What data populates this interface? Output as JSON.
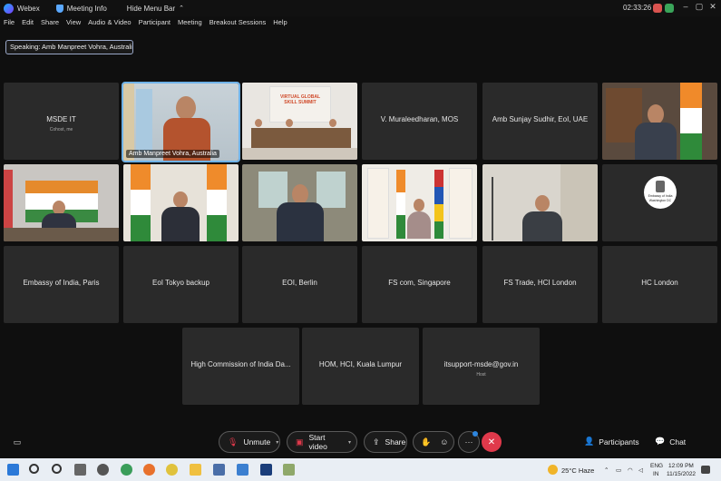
{
  "titlebar": {
    "app_name": "Webex",
    "meeting_info": "Meeting Info",
    "hide_menu": "Hide Menu Bar",
    "clock": "02:33:26"
  },
  "menu": [
    "File",
    "Edit",
    "Share",
    "View",
    "Audio & Video",
    "Participant",
    "Meeting",
    "Breakout Sessions",
    "Help"
  ],
  "speaking": "Speaking: Amb Manpreet Vohra, Australia",
  "tiles": {
    "msde": {
      "name": "MSDE IT",
      "sub": "Cohost, me"
    },
    "vohra": {
      "name": "Amb Manpreet Vohra, Australia"
    },
    "muraleedharan": {
      "name": "V. Muraleedharan, MOS"
    },
    "sudhir": {
      "name": "Amb Sunjay Sudhir, EoI, UAE"
    },
    "paris": {
      "name": "Embassy of India, Paris"
    },
    "tokyo": {
      "name": "EoI Tokyo backup"
    },
    "berlin": {
      "name": "EOI, Berlin"
    },
    "singapore": {
      "name": "FS com, Singapore"
    },
    "fs_london": {
      "name": "FS Trade, HCI London"
    },
    "hc_london": {
      "name": "HC London"
    },
    "hci_da": {
      "name": "High Commission of India Da..."
    },
    "kl": {
      "name": "HOM, HCI, Kuala Lumpur"
    },
    "itsupport": {
      "name": "itsupport-msde@gov.in",
      "sub": "Host"
    }
  },
  "banner_text": {
    "line1": "VIRTUAL GLOBAL",
    "line2": "SKILL SUMMIT"
  },
  "embassy_logo": {
    "line1": "Embassy of India",
    "line2": "Washington DC"
  },
  "controls": {
    "unmute": "Unmute",
    "start_video": "Start video",
    "share": "Share",
    "participants": "Participants",
    "chat": "Chat"
  },
  "taskbar": {
    "weather": "25°C  Haze",
    "lang": "ENG",
    "region": "IN",
    "time": "12:09 PM",
    "date": "11/15/2022"
  },
  "colors": {
    "end_button": "#e0394b",
    "active_border": "#6fb2e8"
  }
}
